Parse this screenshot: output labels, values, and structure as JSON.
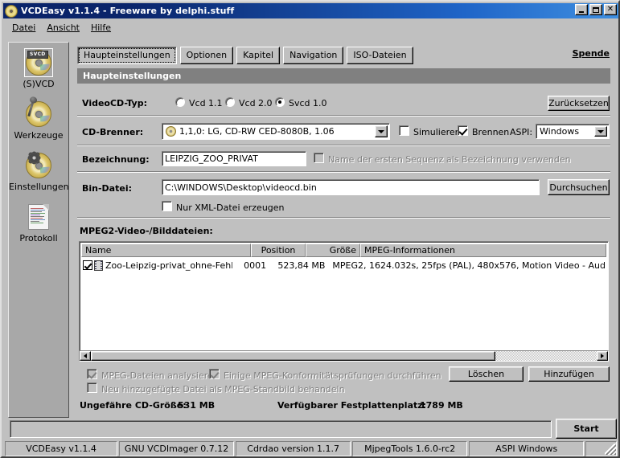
{
  "window": {
    "title": "VCDEasy v1.1.4 - Freeware by delphi.stuff",
    "icon": "disc-icon",
    "minimize_label": "",
    "maximize_label": "",
    "close_label": "✕"
  },
  "menubar": {
    "items": [
      {
        "label": "Datei"
      },
      {
        "label": "Ansicht"
      },
      {
        "label": "Hilfe"
      }
    ]
  },
  "sidebar": {
    "items": [
      {
        "label": "(S)VCD",
        "icon": "svcd-disc-icon",
        "badge": "SVCD",
        "selected": true
      },
      {
        "label": "Werkzeuge",
        "icon": "tools-disc-icon",
        "selected": false
      },
      {
        "label": "Einstellungen",
        "icon": "settings-disc-icon",
        "selected": false
      },
      {
        "label": "Protokoll",
        "icon": "log-document-icon",
        "selected": false
      }
    ]
  },
  "tabs": [
    {
      "label": "Haupteinstellungen",
      "active": true
    },
    {
      "label": "Optionen",
      "active": false
    },
    {
      "label": "Kapitel",
      "active": false
    },
    {
      "label": "Navigation",
      "active": false
    },
    {
      "label": "ISO-Dateien",
      "active": false
    }
  ],
  "donate_link": "Spende",
  "section_header": "Haupteinstellungen",
  "videocd_type": {
    "label": "VideoCD-Typ:",
    "options": [
      {
        "label": "Vcd 1.1",
        "checked": false
      },
      {
        "label": "Vcd 2.0",
        "checked": false
      },
      {
        "label": "Svcd 1.0",
        "checked": true
      }
    ],
    "reset_button": "Zurücksetzen"
  },
  "cd_burner": {
    "label": "CD-Brenner:",
    "value": "1,1,0: LG, CD-RW CED-8080B, 1.06",
    "simulate": {
      "label": "Simulieren",
      "checked": false
    },
    "burn": {
      "label": "Brennen",
      "checked": true
    },
    "aspi": {
      "label": "ASPI:",
      "value": "Windows"
    }
  },
  "designation": {
    "label": "Bezeichnung:",
    "value": "LEIPZIG_ZOO_PRIVAT",
    "use_first_sequence": {
      "label": "Name der ersten Sequenz als Bezeichnung verwenden",
      "checked": false,
      "disabled": true
    }
  },
  "bin_file": {
    "label": "Bin-Datei:",
    "value": "C:\\WINDOWS\\Desktop\\videocd.bin",
    "browse_button": "Durchsuchen",
    "xml_only": {
      "label": "Nur XML-Datei erzeugen",
      "checked": false
    }
  },
  "file_list": {
    "label": "MPEG2-Video-/Bilddateien:",
    "columns": [
      "Name",
      "Position",
      "Größe",
      "MPEG-Informationen"
    ],
    "rows": [
      {
        "checked": true,
        "name": "Zoo-Leipzig-privat_ohne-Fehler.mpg",
        "position": "0001",
        "size": "523,84 MB",
        "mpeg_info": "MPEG2, 1624.032s, 25fps (PAL), 480x576, Motion Video - Aud"
      }
    ]
  },
  "analysis_options": [
    {
      "label": "MPEG-Dateien analysieren",
      "checked": true,
      "disabled": true
    },
    {
      "label": "Einige MPEG-Konformitätsprüfungen durchführen",
      "checked": true,
      "disabled": true
    },
    {
      "label": "Neu hinzugefügte Datei als MPEG-Standbild behandeln",
      "checked": false,
      "disabled": true
    }
  ],
  "list_buttons": {
    "delete": "Löschen",
    "add": "Hinzufügen"
  },
  "size_info": {
    "cd_size_label": "Ungefähre CD-Größe:",
    "cd_size_value": "531 MB",
    "disk_space_label": "Verfügbarer Festplattenplatz:",
    "disk_space_value": "1789 MB"
  },
  "start_button": "Start",
  "statusbar": [
    {
      "label": "VCDEasy v1.1.4"
    },
    {
      "label": "GNU VCDImager 0.7.12"
    },
    {
      "label": "Cdrdao version 1.1.7"
    },
    {
      "label": "MjpegTools 1.6.0-rc2"
    },
    {
      "label": "ASPI Windows"
    },
    {
      "label": ""
    }
  ],
  "colors": {
    "face": "#c0c0c0",
    "titlebar_start": "#0a246a",
    "section_header_bg": "#808080",
    "sidebar_bg": "#a8a8a8",
    "field_bg": "#ffffff",
    "disabled_text": "#808080"
  }
}
